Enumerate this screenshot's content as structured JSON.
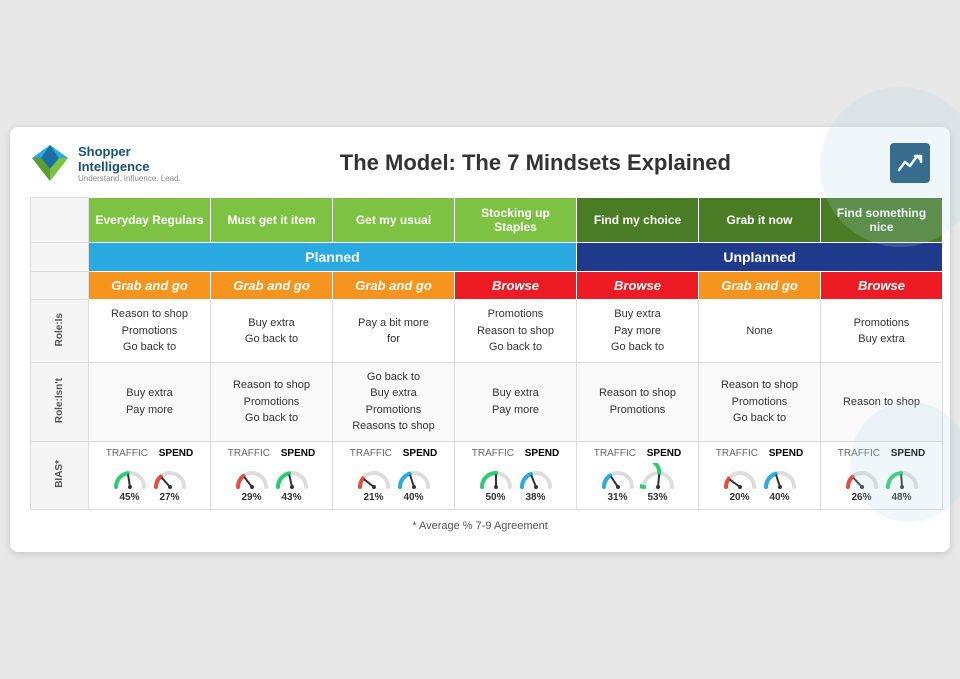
{
  "header": {
    "logo_line1": "Shopper",
    "logo_line2": "Intelligence",
    "logo_tagline": "Understand. Influence. Lead.",
    "title": "The Model: The 7 Mindsets Explained"
  },
  "columns": [
    {
      "label": "Everyday Regulars",
      "dark": false
    },
    {
      "label": "Must get it item",
      "dark": false
    },
    {
      "label": "Get my usual",
      "dark": false
    },
    {
      "label": "Stocking up Staples",
      "dark": false
    },
    {
      "label": "Find my choice",
      "dark": true
    },
    {
      "label": "Grab it now",
      "dark": true
    },
    {
      "label": "Find something nice",
      "dark": true
    }
  ],
  "planned_label": "Planned",
  "unplanned_label": "Unplanned",
  "planned_cols": 4,
  "unplanned_cols": 3,
  "mode_row": [
    {
      "type": "grab",
      "label": "Grab and go"
    },
    {
      "type": "grab",
      "label": "Grab and go"
    },
    {
      "type": "grab",
      "label": "Grab and go"
    },
    {
      "type": "browse",
      "label": "Browse"
    },
    {
      "type": "browse",
      "label": "Browse"
    },
    {
      "type": "grab",
      "label": "Grab and go"
    },
    {
      "type": "browse",
      "label": "Browse"
    }
  ],
  "role_is_label": "Role:Is",
  "role_isnt_label": "Role:Isn't",
  "bias_label": "BIAS*",
  "role_is": [
    "Reason to shop\nPromotions\nGo back to",
    "Buy extra\nGo back to",
    "Pay a bit more\nfor",
    "Promotions\nReason to shop\nGo back to",
    "Buy extra\nPay more\nGo back to",
    "None",
    "Promotions\nBuy extra"
  ],
  "role_isnt": [
    "Buy extra\nPay more",
    "Reason to shop\nPromotions\nGo back to",
    "Go back to\nBuy extra\nPromotions\nReasons to shop",
    "Buy extra\nPay more",
    "Reason to shop\nPromotions",
    "Reason to shop\nPromotions\nGo back to",
    "Reason to shop"
  ],
  "bias": [
    {
      "traffic_pct": "45%",
      "spend_pct": "27%",
      "traffic_up": true,
      "spend_up": false
    },
    {
      "traffic_pct": "29%",
      "spend_pct": "43%",
      "traffic_up": false,
      "spend_up": true
    },
    {
      "traffic_pct": "21%",
      "spend_pct": "40%",
      "traffic_up": false,
      "spend_up": false
    },
    {
      "traffic_pct": "50%",
      "spend_pct": "38%",
      "traffic_up": true,
      "spend_up": false
    },
    {
      "traffic_pct": "31%",
      "spend_pct": "53%",
      "traffic_up": false,
      "spend_up": true
    },
    {
      "traffic_pct": "20%",
      "spend_pct": "40%",
      "traffic_up": false,
      "spend_up": false
    },
    {
      "traffic_pct": "26%",
      "spend_pct": "48%",
      "traffic_up": false,
      "spend_up": true
    }
  ],
  "footnote": "* Average % 7-9 Agreement"
}
